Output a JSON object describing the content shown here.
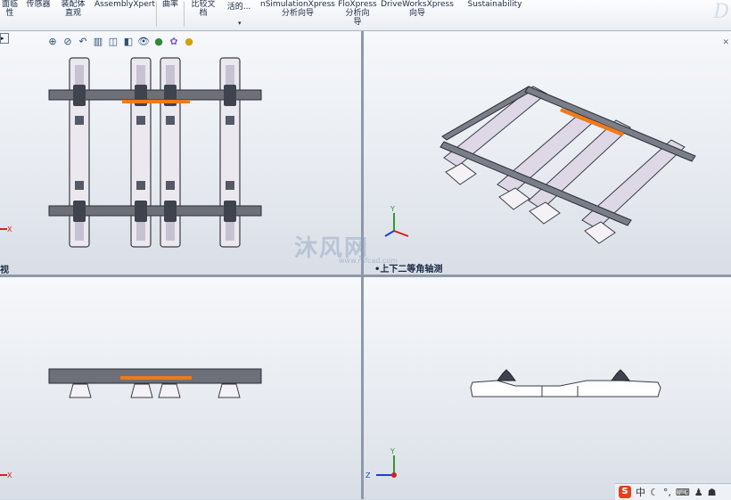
{
  "ribbon": {
    "items": [
      {
        "label": "面临\n性"
      },
      {
        "label": "传感器"
      },
      {
        "label": "装配体\n直观"
      },
      {
        "label": "AssemblyXpert"
      },
      {
        "label": "曲率"
      },
      {
        "label": "比较文\n档"
      },
      {
        "label": "活的..."
      },
      {
        "label": "nSimulationXpress\n分析向导"
      },
      {
        "label": "FloXpress\n分析向\n导"
      },
      {
        "label": "DriveWorksXpress\n向导"
      },
      {
        "label": "Sustainability"
      }
    ]
  },
  "views": {
    "top_left_label": "视",
    "top_right_label": "•上下二等角轴测",
    "axis_x": "X",
    "axis_y": "Y",
    "axis_z": "Z"
  },
  "watermark": {
    "text": "沐风网",
    "url": "www.mfcad.com"
  },
  "tray": {
    "ime_label": "中",
    "icons": [
      "sogou-icon",
      "moon-icon",
      "punctuation-icon",
      "keyboard-icon",
      "user-icon",
      "shirt-icon"
    ]
  },
  "colors": {
    "accent_orange": "#f07a1a",
    "ribbon_text": "#1c2a44",
    "sleeper_fill": "#ddd7e6",
    "rail_fill": "#6d7078"
  }
}
